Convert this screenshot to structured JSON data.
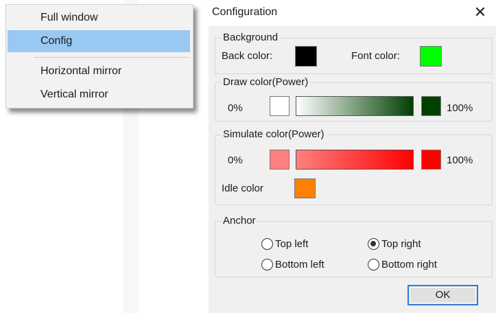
{
  "context_menu": {
    "items": [
      {
        "label": "Full window"
      },
      {
        "label": "Config",
        "selected": true
      },
      {
        "label": "Horizontal mirror"
      },
      {
        "label": "Vertical mirror"
      }
    ]
  },
  "dialog": {
    "title": "Configuration",
    "close_icon": "close-icon",
    "background": {
      "legend": "Background",
      "back_color_label": "Back color:",
      "back_color": "#000000",
      "font_color_label": "Font color:",
      "font_color": "#00ff00"
    },
    "draw_color": {
      "legend": "Draw color(Power)",
      "min_label": "0%",
      "max_label": "100%",
      "start_color": "#ffffff",
      "end_color": "#004000"
    },
    "simulate_color": {
      "legend": "Simulate color(Power)",
      "min_label": "0%",
      "max_label": "100%",
      "start_color": "#ff8080",
      "end_color": "#ff0000",
      "idle_label": "Idle color",
      "idle_color": "#ff8000"
    },
    "anchor": {
      "legend": "Anchor",
      "options": [
        {
          "label": "Top left",
          "checked": false
        },
        {
          "label": "Top right",
          "checked": true
        },
        {
          "label": "Bottom left",
          "checked": false
        },
        {
          "label": "Bottom right",
          "checked": false
        }
      ]
    },
    "ok_label": "OK"
  }
}
